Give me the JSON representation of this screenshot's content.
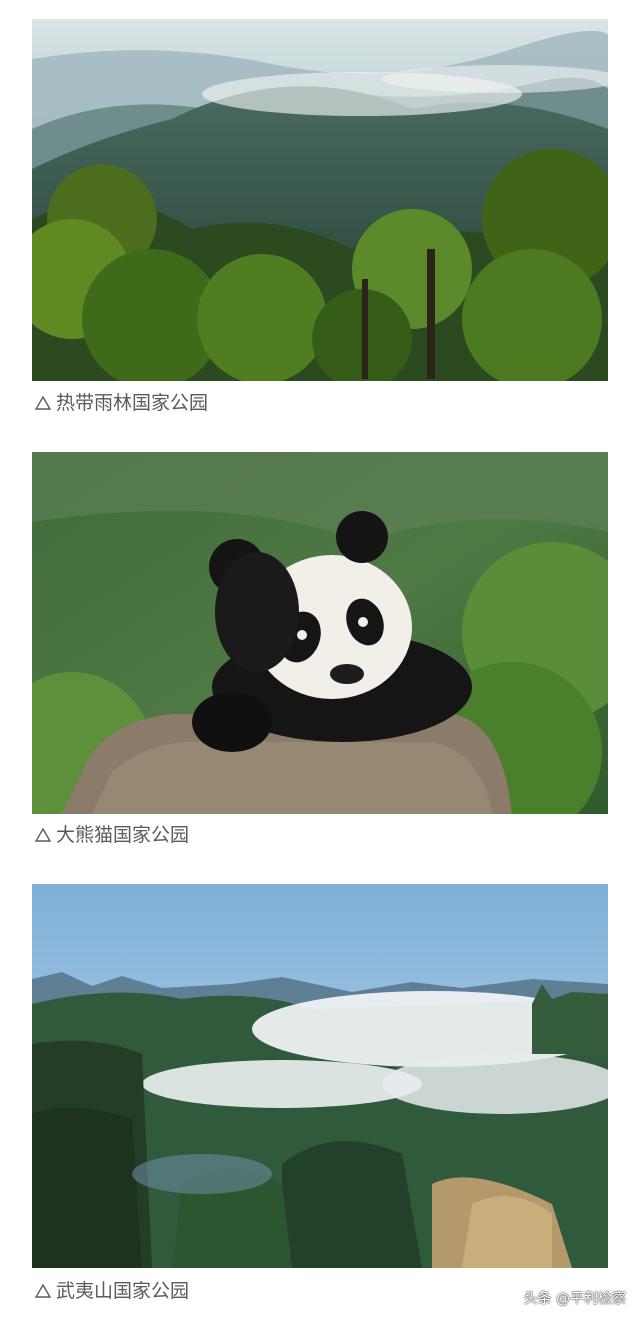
{
  "captions": [
    {
      "prefix": "△",
      "text": "热带雨林国家公园",
      "image": "tropical-rainforest-mountains"
    },
    {
      "prefix": "△",
      "text": "大熊猫国家公园",
      "image": "giant-panda-on-rock"
    },
    {
      "prefix": "△",
      "text": "武夷山国家公园",
      "image": "wuyi-mountains-sea-of-clouds"
    }
  ],
  "watermark": "头条 @平利检察",
  "colors": {
    "caption_text": "#5b5b5b",
    "background": "#ffffff"
  }
}
